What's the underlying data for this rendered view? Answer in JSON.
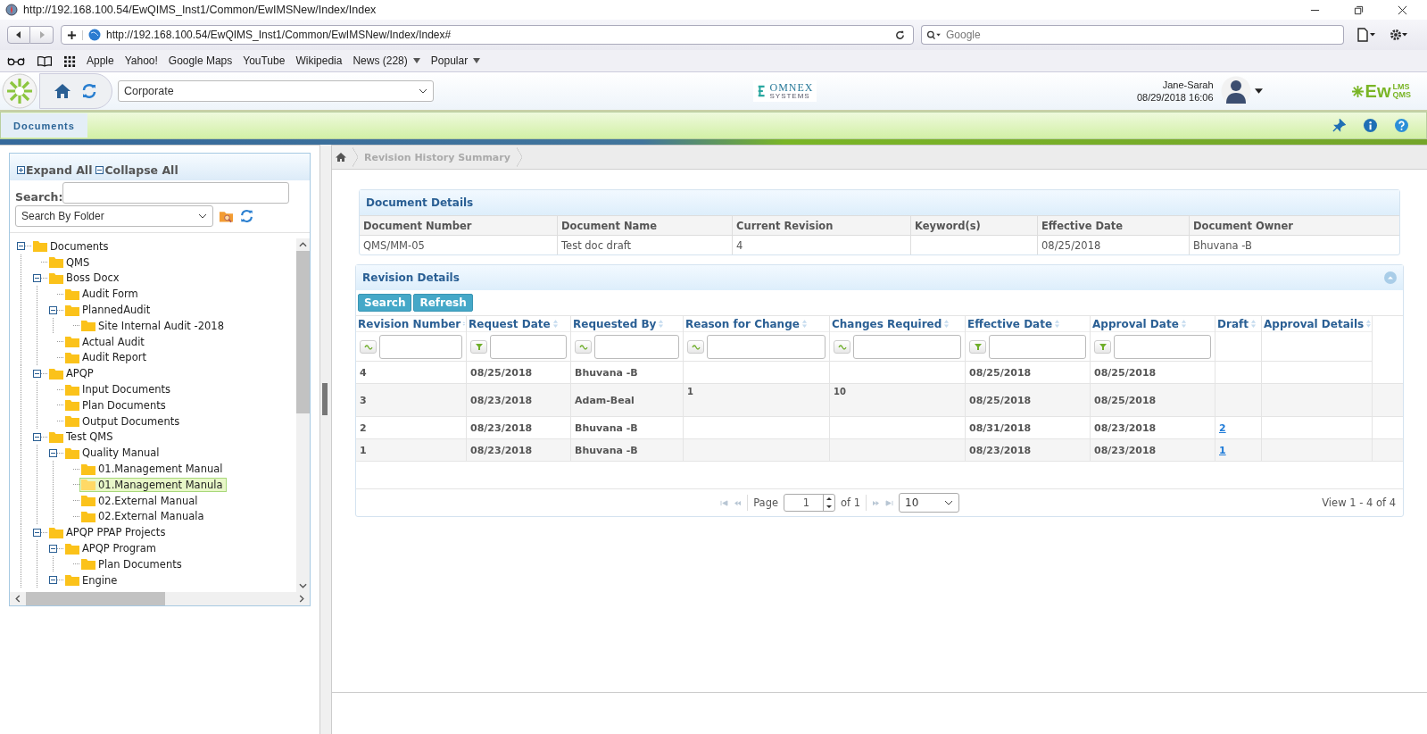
{
  "browser": {
    "title": "http://192.168.100.54/EwQIMS_Inst1/Common/EwIMSNew/Index/Index",
    "url": "http://192.168.100.54/EwQIMS_Inst1/Common/EwIMSNew/Index/Index#",
    "search_placeholder": "Google",
    "bookmarks": [
      {
        "label": "Apple",
        "menu": false
      },
      {
        "label": "Yahoo!",
        "menu": false
      },
      {
        "label": "Google Maps",
        "menu": false
      },
      {
        "label": "YouTube",
        "menu": false
      },
      {
        "label": "Wikipedia",
        "menu": false
      },
      {
        "label": "News (228)",
        "menu": true
      },
      {
        "label": "Popular",
        "menu": true
      }
    ]
  },
  "app_header": {
    "company": "Corporate",
    "omnex_logo": {
      "name": "OMNEX",
      "tagline": "SYSTEMS"
    },
    "user": "Jane-Sarah",
    "datetime": "08/29/2018 16:06",
    "product_logo": {
      "name": "Ew",
      "upper": "LMS",
      "lower": "QMS"
    }
  },
  "tabs": [
    {
      "label": "Documents",
      "selected": true
    }
  ],
  "tree_panel": {
    "expand_all": "Expand All",
    "collapse_all": "Collapse All",
    "search_label": "Search:",
    "search_mode": "Search By Folder",
    "nodes": [
      {
        "label": "Documents",
        "selected": false,
        "expanded": true,
        "children": [
          {
            "label": "QMS",
            "selected": false
          },
          {
            "label": "Boss Docx",
            "selected": false,
            "expanded": true,
            "children": [
              {
                "label": "Audit Form",
                "selected": false
              },
              {
                "label": "PlannedAudit",
                "selected": false,
                "expanded": true,
                "children": [
                  {
                    "label": "Site Internal Audit -2018",
                    "selected": false
                  }
                ]
              },
              {
                "label": "Actual Audit",
                "selected": false
              },
              {
                "label": "Audit Report",
                "selected": false
              }
            ]
          },
          {
            "label": "APQP",
            "selected": false,
            "expanded": true,
            "children": [
              {
                "label": "Input Documents",
                "selected": false
              },
              {
                "label": "Plan Documents",
                "selected": false
              },
              {
                "label": "Output Documents",
                "selected": false
              }
            ]
          },
          {
            "label": "Test QMS",
            "selected": false,
            "expanded": true,
            "children": [
              {
                "label": "Quality Manual",
                "selected": false,
                "expanded": true,
                "children": [
                  {
                    "label": "01.Management Manual",
                    "selected": false
                  },
                  {
                    "label": "01.Management Manula",
                    "selected": true
                  },
                  {
                    "label": "02.External Manual",
                    "selected": false
                  },
                  {
                    "label": "02.External Manuala",
                    "selected": false
                  }
                ]
              }
            ]
          },
          {
            "label": "APQP PPAP Projects",
            "selected": false,
            "expanded": true,
            "children": [
              {
                "label": "APQP Program",
                "selected": false,
                "expanded": true,
                "children": [
                  {
                    "label": "Plan Documents",
                    "selected": false
                  }
                ]
              },
              {
                "label": "Engine",
                "selected": false,
                "expanded": true
              }
            ]
          }
        ]
      }
    ]
  },
  "breadcrumb": [
    "Revision History Summary"
  ],
  "document_details": {
    "title": "Document Details",
    "columns": [
      "Document Number",
      "Document Name",
      "Current Revision",
      "Keyword(s)",
      "Effective Date",
      "Document Owner"
    ],
    "row": {
      "document_number": "QMS/MM-05",
      "document_name": "Test doc draft",
      "current_revision": "4",
      "effective_date": "08/25/2018",
      "document_owner": "Bhuvana -B"
    }
  },
  "revision_details": {
    "title": "Revision Details",
    "buttons": [
      "Search",
      "Refresh"
    ],
    "columns": [
      {
        "label": "Revision Number",
        "kind": "text"
      },
      {
        "label": "Request Date",
        "kind": "date"
      },
      {
        "label": "Requested By",
        "kind": "text"
      },
      {
        "label": "Reason for Change",
        "kind": "text"
      },
      {
        "label": "Changes Required",
        "kind": "text"
      },
      {
        "label": "Effective Date",
        "kind": "date"
      },
      {
        "label": "Approval Date",
        "kind": "date"
      },
      {
        "label": "Draft",
        "kind": "plain"
      },
      {
        "label": "Approval Details",
        "kind": "plain"
      }
    ],
    "rows": [
      {
        "revision_number": "4",
        "request_date": "08/25/2018",
        "requested_by": "Bhuvana -B",
        "effective_date": "08/25/2018",
        "approval_date": "08/25/2018"
      },
      {
        "revision_number": "3",
        "request_date": "08/23/2018",
        "requested_by": "Adam-Beal",
        "reason_for_change": "1",
        "changes_required": "10",
        "effective_date": "08/25/2018",
        "approval_date": "08/25/2018"
      },
      {
        "revision_number": "2",
        "request_date": "08/23/2018",
        "requested_by": "Bhuvana -B",
        "effective_date": "08/31/2018",
        "approval_date": "08/23/2018",
        "draft": "2"
      },
      {
        "revision_number": "1",
        "request_date": "08/23/2018",
        "requested_by": "Bhuvana -B",
        "effective_date": "08/23/2018",
        "approval_date": "08/23/2018",
        "draft": "1"
      }
    ],
    "pager": {
      "page_label": "Page",
      "page": "1",
      "of_label": "of 1",
      "page_size": "10",
      "summary": "View 1 - 4 of 4"
    }
  }
}
